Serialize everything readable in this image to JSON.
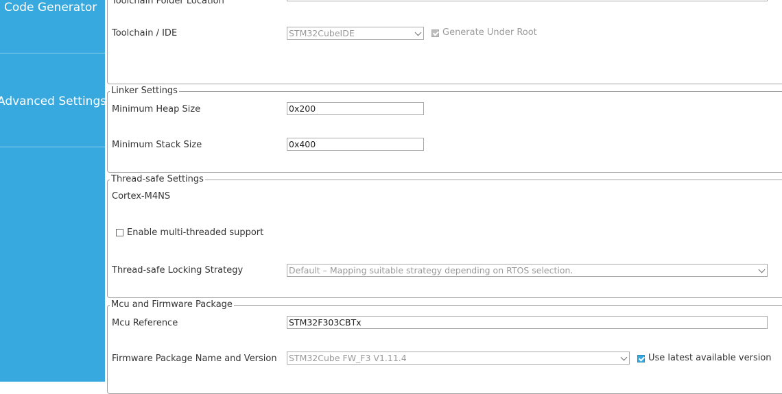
{
  "sidebar": {
    "items": [
      {
        "label": "Code Generator"
      },
      {
        "label": "Advanced Settings"
      }
    ]
  },
  "project_section": {
    "toolchain_folder_label": "Toolchain Folder Location",
    "toolchain_label": "Toolchain / IDE",
    "toolchain_value": "STM32CubeIDE",
    "generate_under_root_label": "Generate Under Root",
    "generate_under_root_checked": true
  },
  "linker": {
    "title": "Linker Settings",
    "heap_label": "Minimum Heap Size",
    "heap_value": "0x200",
    "stack_label": "Minimum Stack Size",
    "stack_value": "0x400"
  },
  "thread_safe": {
    "title": "Thread-safe Settings",
    "core_label": "Cortex-M4NS",
    "multithread_label": "Enable multi-threaded support",
    "multithread_checked": false,
    "locking_label": "Thread-safe Locking Strategy",
    "locking_value": "Default – Mapping suitable strategy depending on RTOS selection."
  },
  "mcu": {
    "title": "Mcu and Firmware Package",
    "mcu_ref_label": "Mcu Reference",
    "mcu_ref_value": "STM32F303CBTx",
    "fw_label": "Firmware Package Name and Version",
    "fw_value": "STM32Cube FW_F3 V1.11.4",
    "use_latest_label": "Use latest available version",
    "use_latest_checked": true
  },
  "colors": {
    "sidebar_bg": "#37a9de",
    "accent": "#37a9de"
  }
}
